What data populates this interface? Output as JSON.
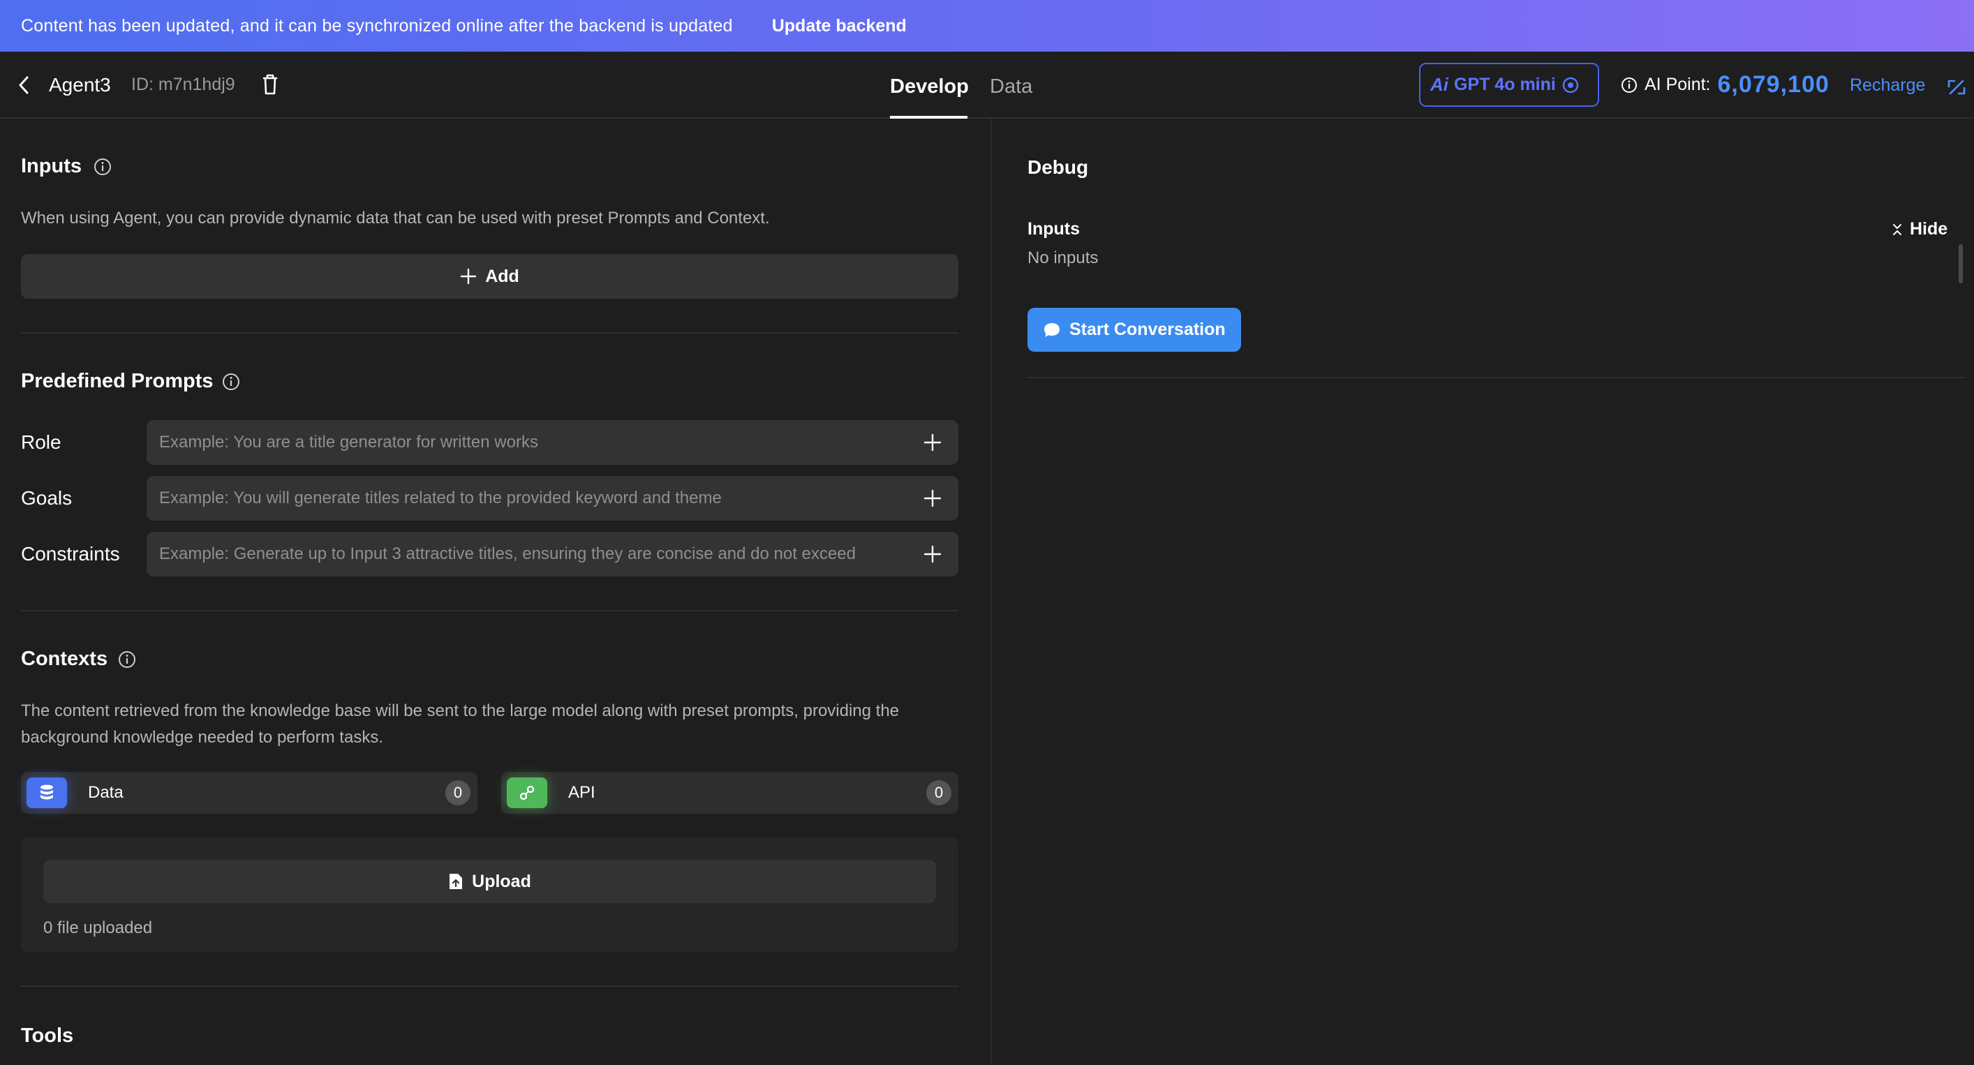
{
  "banner": {
    "message": "Content has been updated, and it can be synchronized online after the backend is updated",
    "action": "Update backend"
  },
  "header": {
    "agent_name": "Agent3",
    "agent_id": "ID: m7n1hdj9",
    "tabs": [
      {
        "label": "Develop",
        "active": true
      },
      {
        "label": "Data",
        "active": false
      }
    ],
    "model": {
      "prefix": "Ai",
      "name": "GPT 4o mini"
    },
    "points": {
      "label": "AI Point:",
      "value": "6,079,100"
    },
    "recharge": "Recharge"
  },
  "inputs": {
    "title": "Inputs",
    "description": "When using Agent, you can provide dynamic data that can be used with preset Prompts and Context.",
    "add_label": "Add"
  },
  "prompts": {
    "title": "Predefined Prompts",
    "rows": [
      {
        "label": "Role",
        "placeholder": "Example: You are a title generator for written works"
      },
      {
        "label": "Goals",
        "placeholder": "Example: You will generate titles related to the provided keyword and theme"
      },
      {
        "label": "Constraints",
        "placeholder": "Example: Generate up to Input 3 attractive titles, ensuring they are concise and do not exceed"
      }
    ]
  },
  "contexts": {
    "title": "Contexts",
    "description": "The content retrieved from the knowledge base will be sent to the large model along with preset prompts, providing the background knowledge needed to perform tasks.",
    "cards": [
      {
        "label": "Data",
        "count": "0"
      },
      {
        "label": "API",
        "count": "0"
      }
    ],
    "upload_label": "Upload",
    "uploaded_text": "0 file uploaded"
  },
  "tools": {
    "title": "Tools"
  },
  "debug": {
    "title": "Debug",
    "inputs_label": "Inputs",
    "no_inputs": "No inputs",
    "hide_label": "Hide",
    "start_label": "Start Conversation"
  },
  "colors": {
    "accent_blue": "#3b8cf0",
    "points_blue": "#4a8fff",
    "model_blue": "#5b74ff",
    "data_icon": "#4a72ee",
    "api_icon": "#4fb85a"
  }
}
